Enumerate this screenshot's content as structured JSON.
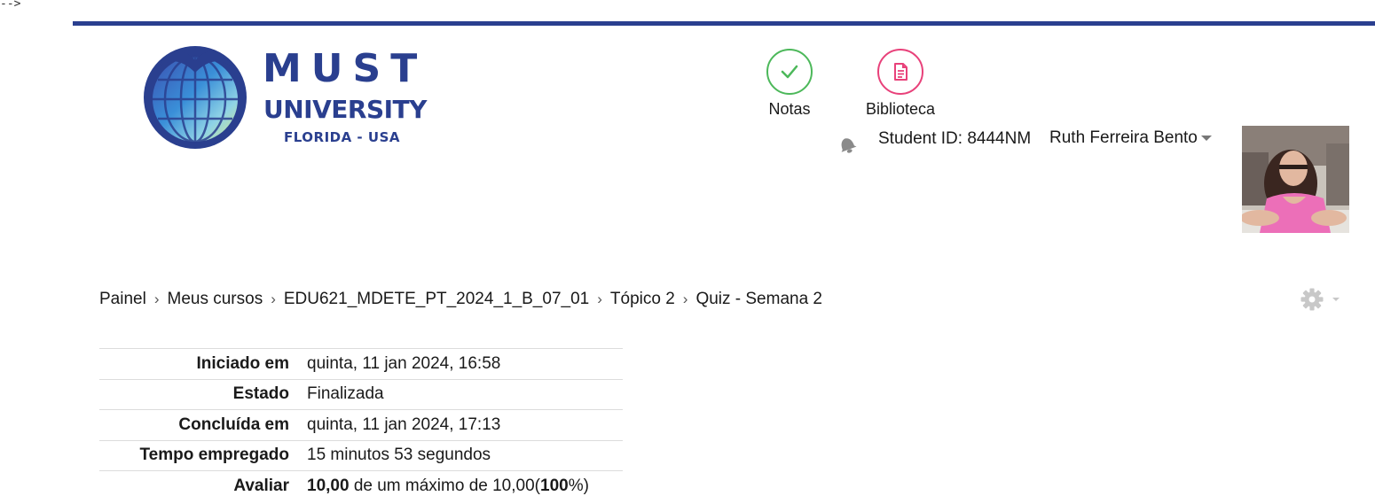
{
  "stray_text": "-->",
  "colors": {
    "brand": "#2a3f8f",
    "notas_accent": "#4cb85a",
    "biblioteca_accent": "#e8417a"
  },
  "logo": {
    "word1": "MUST",
    "word2": "UNIVERSITY",
    "word3": "FLORIDA - USA"
  },
  "header": {
    "notas": {
      "label": "Notas",
      "icon": "check-icon"
    },
    "biblioteca": {
      "label": "Biblioteca",
      "icon": "document-icon"
    },
    "notification_icon": "bell-icon",
    "student_id": "Student ID: 8444NM",
    "user_name": "Ruth Ferreira Bento"
  },
  "breadcrumb": [
    "Painel",
    "Meus cursos",
    "EDU621_MDETE_PT_2024_1_B_07_01",
    "Tópico 2",
    "Quiz - Semana 2"
  ],
  "settings_icon": "gear-icon",
  "summary": {
    "rows": [
      {
        "label": "Iniciado em",
        "value": "quinta, 11 jan 2024, 16:58"
      },
      {
        "label": "Estado",
        "value": "Finalizada"
      },
      {
        "label": "Concluída em",
        "value": "quinta, 11 jan 2024, 17:13"
      },
      {
        "label": "Tempo empregado",
        "value": "15 minutos 53 segundos"
      }
    ],
    "grade": {
      "label": "Avaliar",
      "score": "10,00",
      "text_mid": " de um máximo de 10,00(",
      "percent": "100",
      "text_end": "%)"
    }
  }
}
